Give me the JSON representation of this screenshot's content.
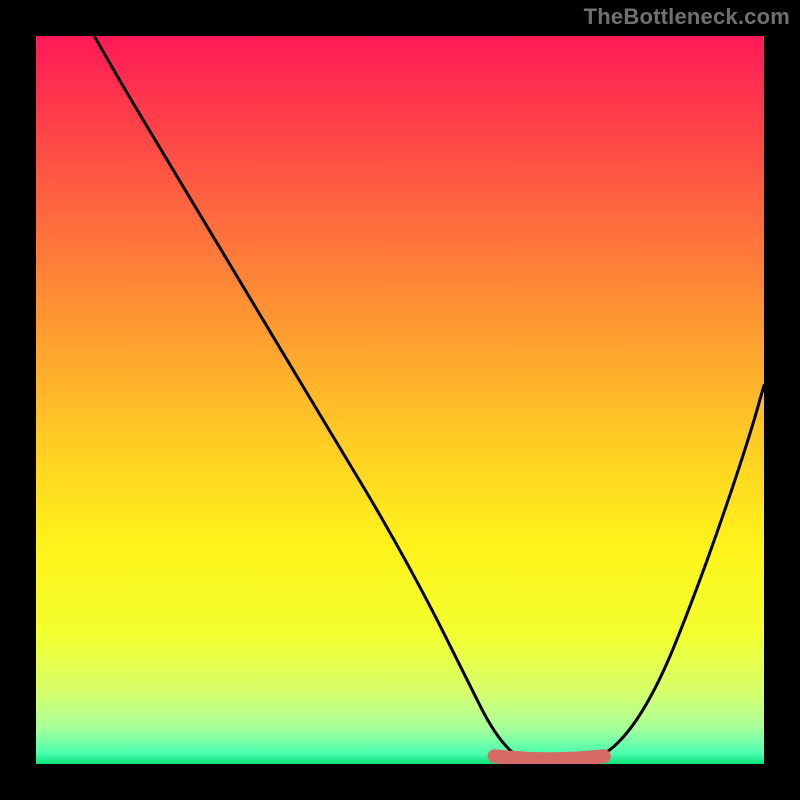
{
  "watermark": "TheBottleneck.com",
  "colors": {
    "background": "#000000",
    "watermark": "#72706f",
    "curve": "#000000",
    "flat_marker": "#d66a65",
    "gradient_stops": [
      {
        "offset": 0.0,
        "color": "#ff1a57"
      },
      {
        "offset": 0.1,
        "color": "#ff3a4b"
      },
      {
        "offset": 0.25,
        "color": "#ff6a3e"
      },
      {
        "offset": 0.4,
        "color": "#ff9a31"
      },
      {
        "offset": 0.55,
        "color": "#ffca24"
      },
      {
        "offset": 0.7,
        "color": "#fff31a"
      },
      {
        "offset": 0.82,
        "color": "#f2ff2e"
      },
      {
        "offset": 0.9,
        "color": "#d7ff6a"
      },
      {
        "offset": 0.95,
        "color": "#a8ff9a"
      },
      {
        "offset": 0.985,
        "color": "#4dffb0"
      },
      {
        "offset": 1.0,
        "color": "#08e37a"
      }
    ]
  },
  "chart_data": {
    "type": "line",
    "title": "",
    "xlabel": "",
    "ylabel": "",
    "xlim": [
      0,
      100
    ],
    "ylim": [
      0,
      100
    ],
    "grid": false,
    "series": [
      {
        "name": "bottleneck-curve",
        "x": [
          8,
          12,
          18,
          24,
          30,
          36,
          42,
          48,
          54,
          58,
          60,
          62,
          64,
          66,
          70,
          74,
          78,
          82,
          86,
          90,
          94,
          98,
          100
        ],
        "y": [
          100,
          93,
          83,
          73,
          63,
          53,
          43,
          33,
          22,
          14,
          10,
          6,
          3,
          1,
          0,
          0,
          1,
          5,
          12,
          22,
          33,
          45,
          52
        ]
      }
    ],
    "annotations": [
      {
        "name": "flat-minimum-marker",
        "x_range": [
          63,
          78
        ],
        "y": 0.8,
        "note": "thick rounded highlight segment near curve minimum"
      }
    ]
  }
}
